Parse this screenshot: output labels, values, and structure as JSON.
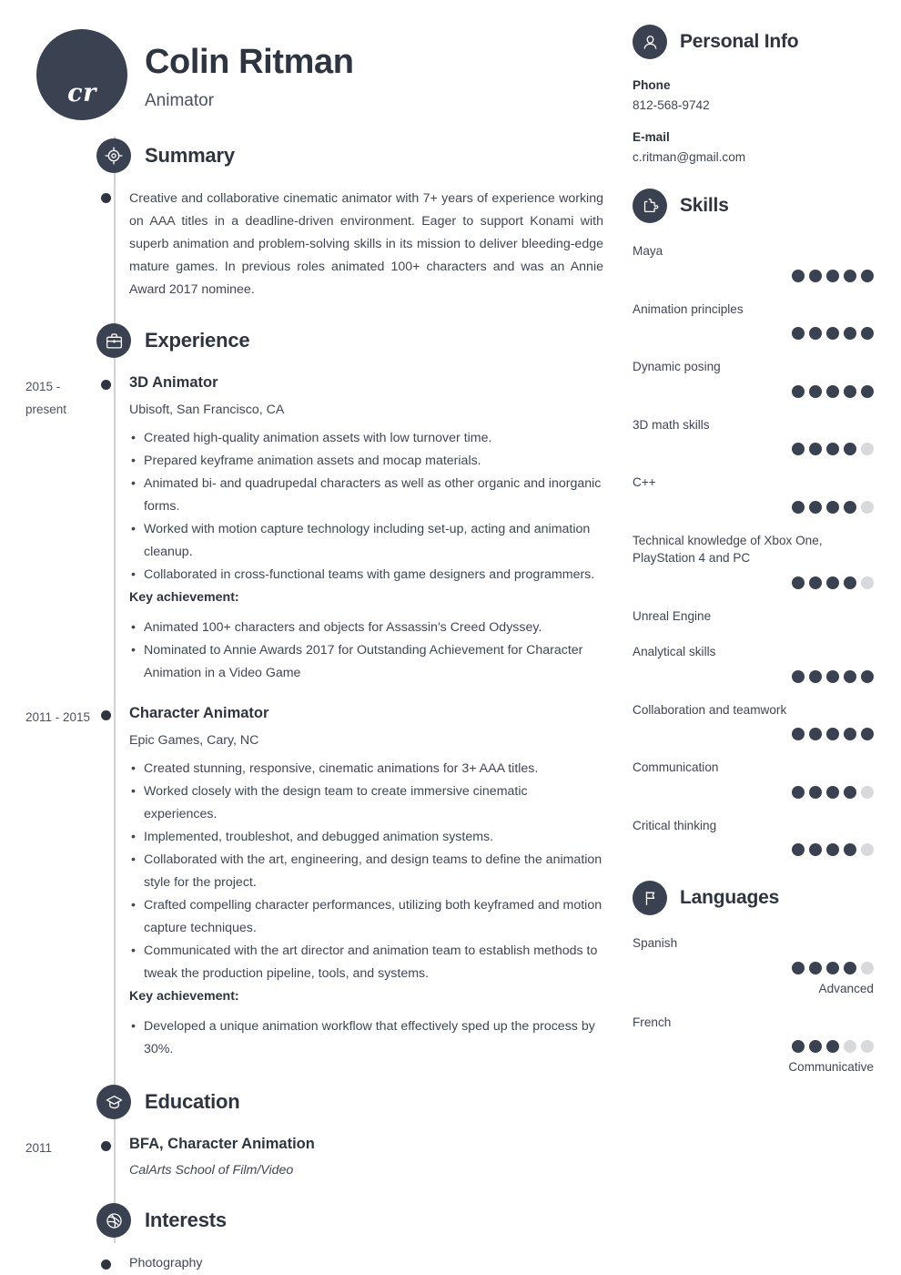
{
  "header": {
    "monogram": "cr",
    "name": "Colin Ritman",
    "title": "Animator"
  },
  "left_sections": {
    "summary": {
      "heading": "Summary",
      "icon": "target-icon",
      "text": "Creative and collaborative cinematic animator with 7+ years of experience working on AAA titles in a deadline-driven environment. Eager to support Konami with superb animation and problem-solving skills in its mission to deliver bleeding-edge mature games. In previous roles animated 100+ characters and was an Annie Award 2017 nominee."
    },
    "experience": {
      "heading": "Experience",
      "icon": "briefcase-icon",
      "jobs": [
        {
          "date": "2015 - present",
          "role": "3D Animator",
          "company": "Ubisoft, San Francisco, CA",
          "bullets": [
            "Created high-quality animation assets with low turnover time.",
            "Prepared keyframe animation assets and mocap materials.",
            "Animated bi- and quadrupedal characters as well as other organic and inorganic forms.",
            "Worked with motion capture technology including set-up, acting and animation cleanup.",
            "Collaborated in cross-functional teams with game designers and programmers."
          ],
          "key_achievement_label": "Key achievement:",
          "achievements": [
            "Animated 100+ characters and objects for Assassin's Creed Odyssey.",
            "Nominated to Annie Awards 2017 for Outstanding Achievement for Character Animation in a Video Game"
          ]
        },
        {
          "date": "2011 - 2015",
          "role": "Character Animator",
          "company": "Epic Games, Cary, NC",
          "bullets": [
            "Created stunning, responsive, cinematic animations for 3+ AAA titles.",
            "Worked closely with the design team to create immersive cinematic experiences.",
            "Implemented, troubleshot, and debugged animation systems.",
            "Collaborated with the art, engineering, and design teams to define the animation style for the project.",
            "Crafted compelling character performances, utilizing both keyframed and motion capture techniques.",
            "Communicated with the art director and animation team to establish methods to tweak the production pipeline, tools, and systems."
          ],
          "key_achievement_label": "Key achievement:",
          "achievements": [
            "Developed a unique animation workflow that effectively sped up the process by 30%."
          ]
        }
      ]
    },
    "education": {
      "heading": "Education",
      "icon": "graduation-cap-icon",
      "entries": [
        {
          "date": "2011",
          "degree": "BFA, Character Animation",
          "school": "CalArts School of Film/Video"
        }
      ]
    },
    "interests": {
      "heading": "Interests",
      "icon": "basketball-icon",
      "items": [
        "Photography"
      ]
    }
  },
  "right_sections": {
    "personal_info": {
      "heading": "Personal Info",
      "icon": "person-icon",
      "fields": [
        {
          "label": "Phone",
          "value": "812-568-9742"
        },
        {
          "label": "E-mail",
          "value": "c.ritman@gmail.com"
        }
      ]
    },
    "skills": {
      "heading": "Skills",
      "icon": "puzzle-icon",
      "max_rating": 5,
      "items": [
        {
          "name": "Maya",
          "rating": 5
        },
        {
          "name": "Animation principles",
          "rating": 5
        },
        {
          "name": "Dynamic posing",
          "rating": 5
        },
        {
          "name": "3D math skills",
          "rating": 4
        },
        {
          "name": "C++",
          "rating": 4
        },
        {
          "name": "Technical knowledge of Xbox One, PlayStation 4 and PC",
          "rating": 4
        },
        {
          "name": "Unreal Engine",
          "rating": null
        },
        {
          "name": "Analytical skills",
          "rating": 5
        },
        {
          "name": "Collaboration and teamwork",
          "rating": 5
        },
        {
          "name": "Communication",
          "rating": 4
        },
        {
          "name": "Critical thinking",
          "rating": 4
        }
      ]
    },
    "languages": {
      "heading": "Languages",
      "icon": "flag-icon",
      "max_rating": 5,
      "items": [
        {
          "name": "Spanish",
          "rating": 4,
          "level": "Advanced"
        },
        {
          "name": "French",
          "rating": 3,
          "level": "Communicative"
        }
      ]
    }
  },
  "colors": {
    "accent_dark": "#3a4151",
    "text_dark": "#2e3440",
    "text_body": "#3f4655",
    "dot_off": "#d8d9db",
    "rail": "#d2d3d6"
  }
}
